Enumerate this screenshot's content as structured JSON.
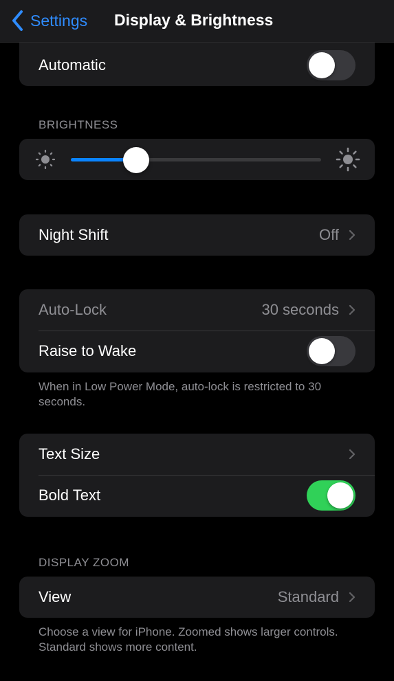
{
  "navbar": {
    "back_label": "Settings",
    "title": "Display & Brightness"
  },
  "appearance": {
    "automatic_label": "Automatic",
    "automatic_on": false
  },
  "brightness": {
    "header": "BRIGHTNESS",
    "level": 0.26
  },
  "night_shift": {
    "label": "Night Shift",
    "value": "Off"
  },
  "lock": {
    "auto_lock_label": "Auto-Lock",
    "auto_lock_value": "30 seconds",
    "raise_to_wake_label": "Raise to Wake",
    "raise_to_wake_on": false,
    "footnote": "When in Low Power Mode, auto-lock is restricted to 30 seconds."
  },
  "text": {
    "text_size_label": "Text Size",
    "bold_text_label": "Bold Text",
    "bold_text_on": true
  },
  "display_zoom": {
    "header": "DISPLAY ZOOM",
    "view_label": "View",
    "view_value": "Standard",
    "footnote": "Choose a view for iPhone. Zoomed shows larger controls. Standard shows more content."
  },
  "colors": {
    "accent": "#0a84ff",
    "toggle_on": "#30d158",
    "background": "#000000",
    "cell": "#1c1c1e"
  }
}
